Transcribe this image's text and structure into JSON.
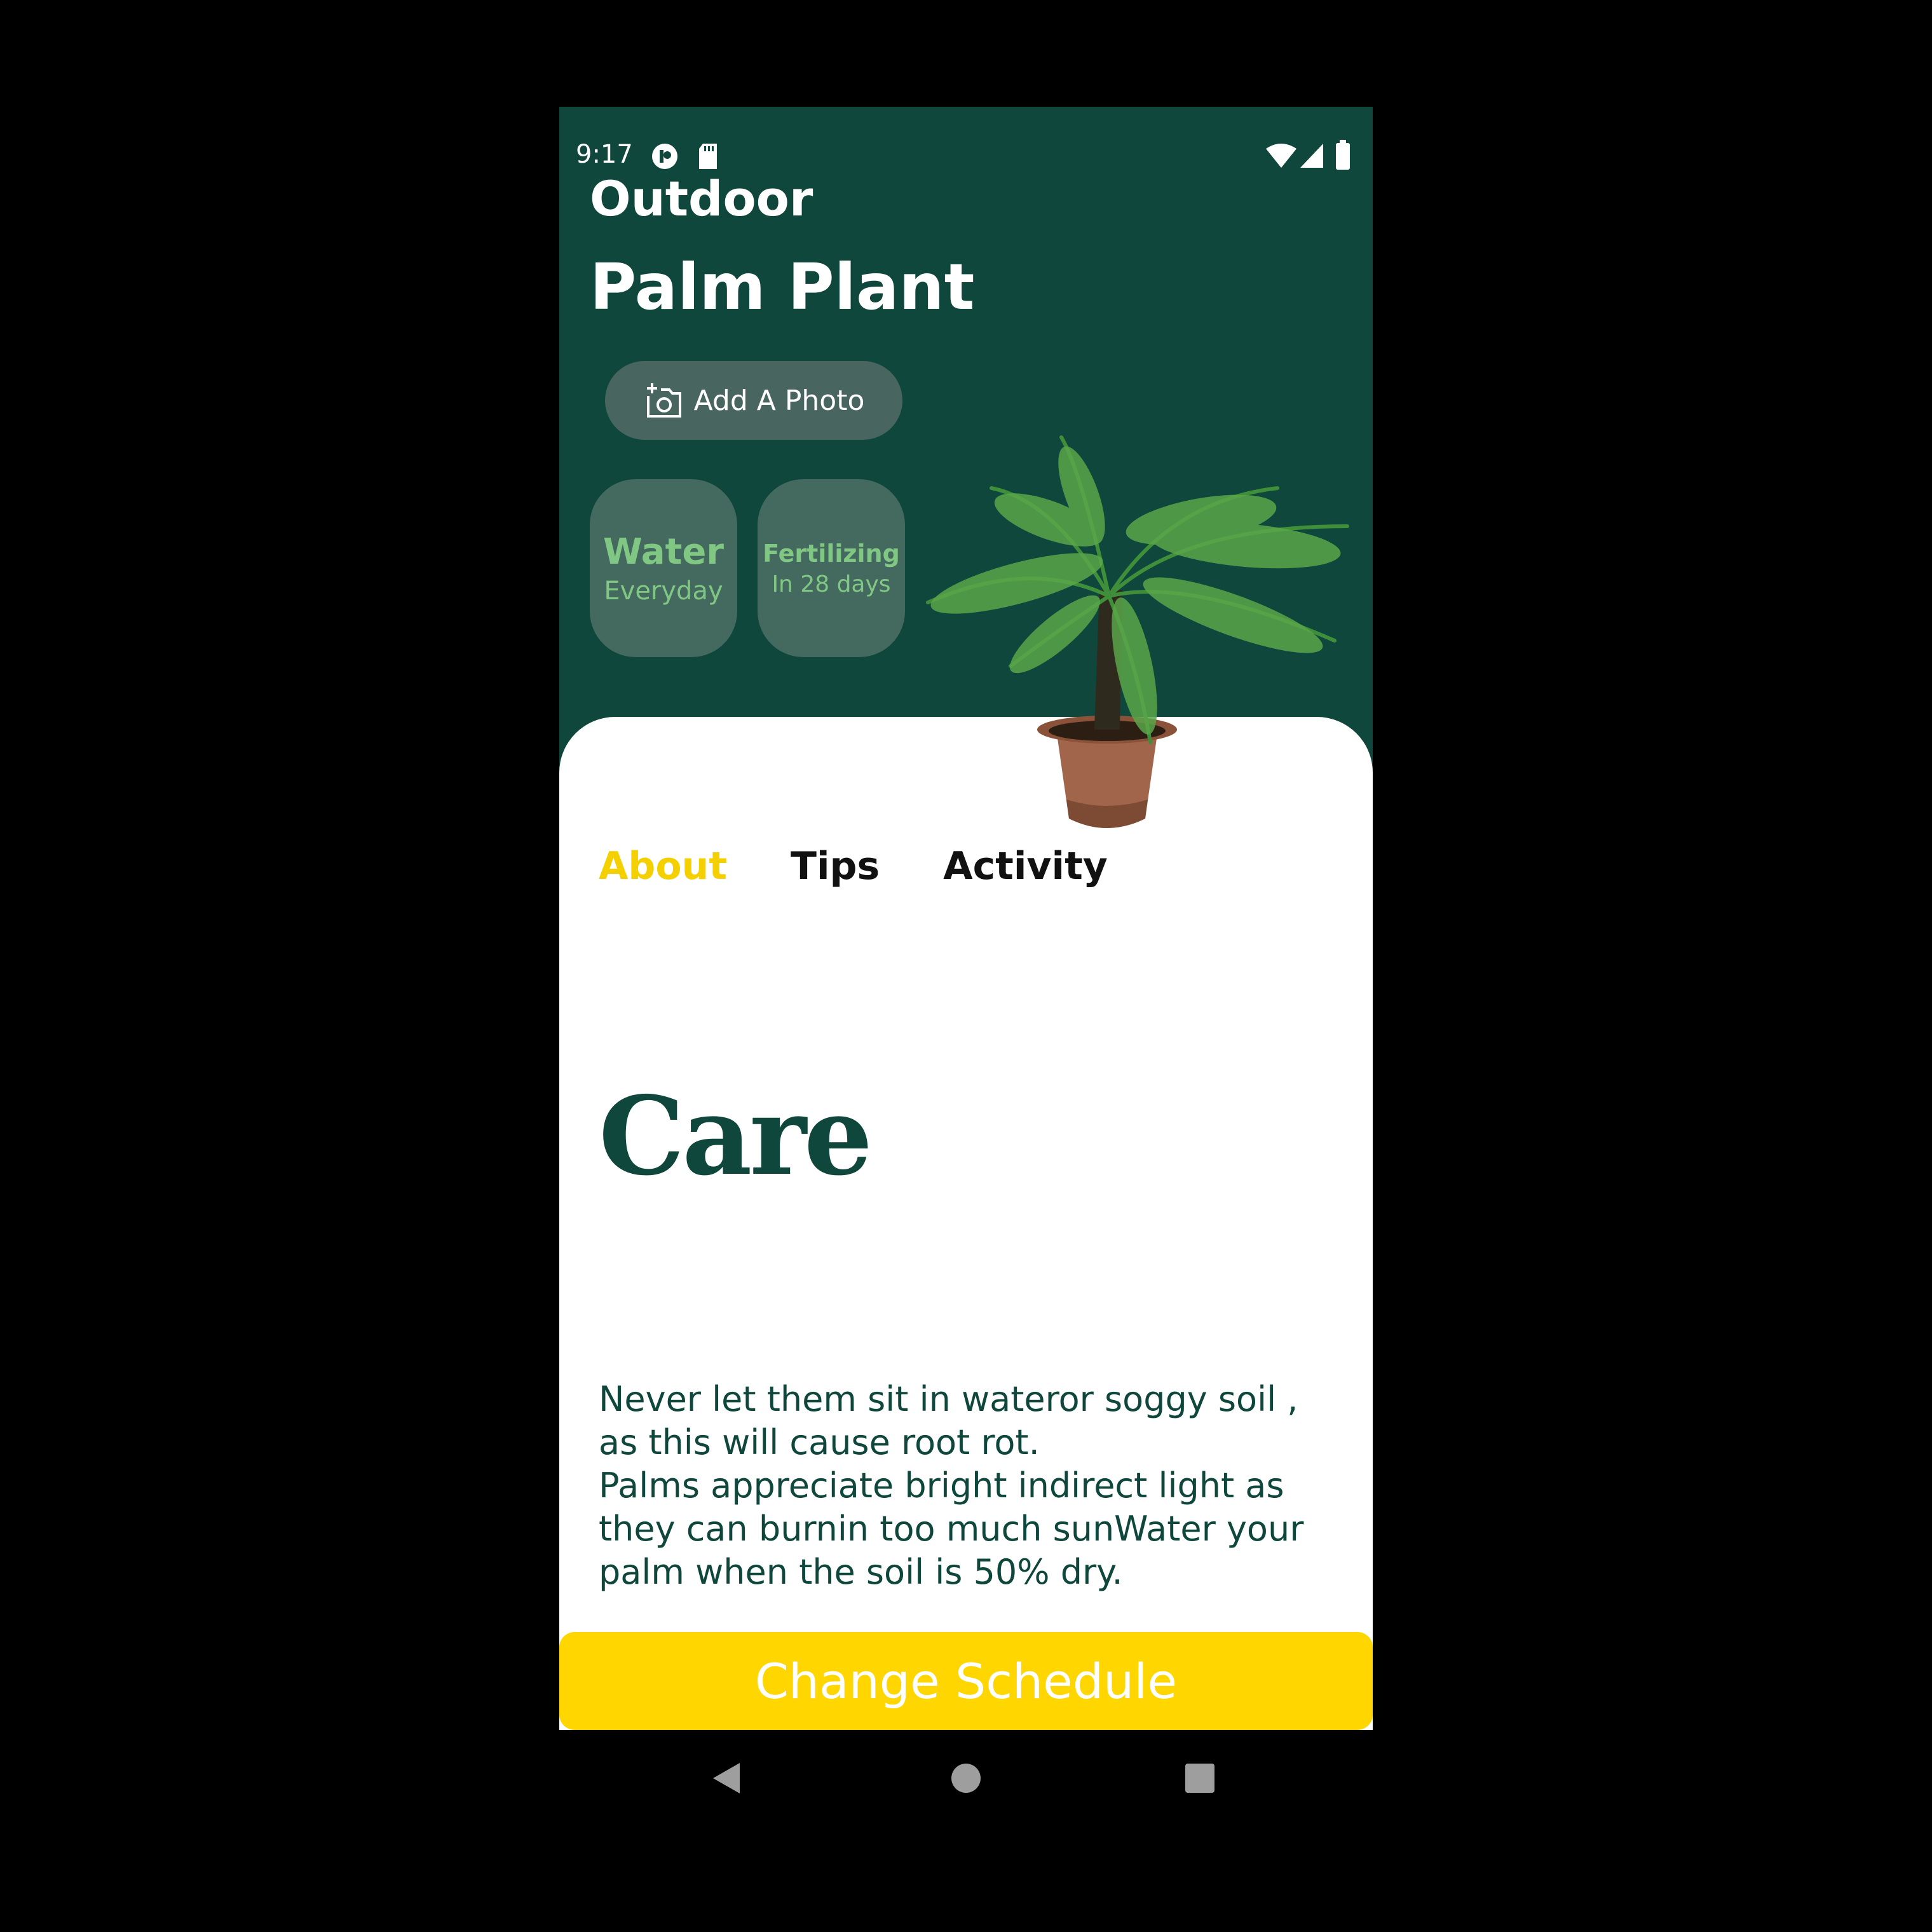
{
  "status_bar": {
    "time": "9:17"
  },
  "header": {
    "category": "Outdoor",
    "title": "Palm Plant",
    "add_photo_label": "Add A Photo"
  },
  "schedule": {
    "water": {
      "title": "Water",
      "subtitle": "Everyday"
    },
    "fertilizing": {
      "title": "Fertilizing",
      "subtitle": "In 28 days"
    }
  },
  "tabs": [
    {
      "label": "About",
      "active": true
    },
    {
      "label": "Tips",
      "active": false
    },
    {
      "label": "Activity",
      "active": false
    }
  ],
  "about": {
    "heading": "Care",
    "lines": [
      "Never let them sit in wateror soggy soil ,",
      "as this will cause root rot.",
      "Palms appreciate bright indirect light as",
      "they can burnin too much sunWater your",
      "palm when the soil is 50% dry."
    ]
  },
  "footer": {
    "button_label": "Change Schedule"
  },
  "colors": {
    "primary_dark_green": "#10473c",
    "card_green": "#446a60",
    "card_text": "#81c784",
    "accent_yellow": "#ffd600",
    "active_tab": "#f5d000"
  },
  "icons": {
    "status": [
      "notification-icon",
      "sd-card-icon",
      "wifi-icon",
      "signal-icon",
      "battery-icon"
    ],
    "photo": "add-photo-icon",
    "nav": [
      "back-icon",
      "home-icon",
      "recents-icon"
    ]
  }
}
